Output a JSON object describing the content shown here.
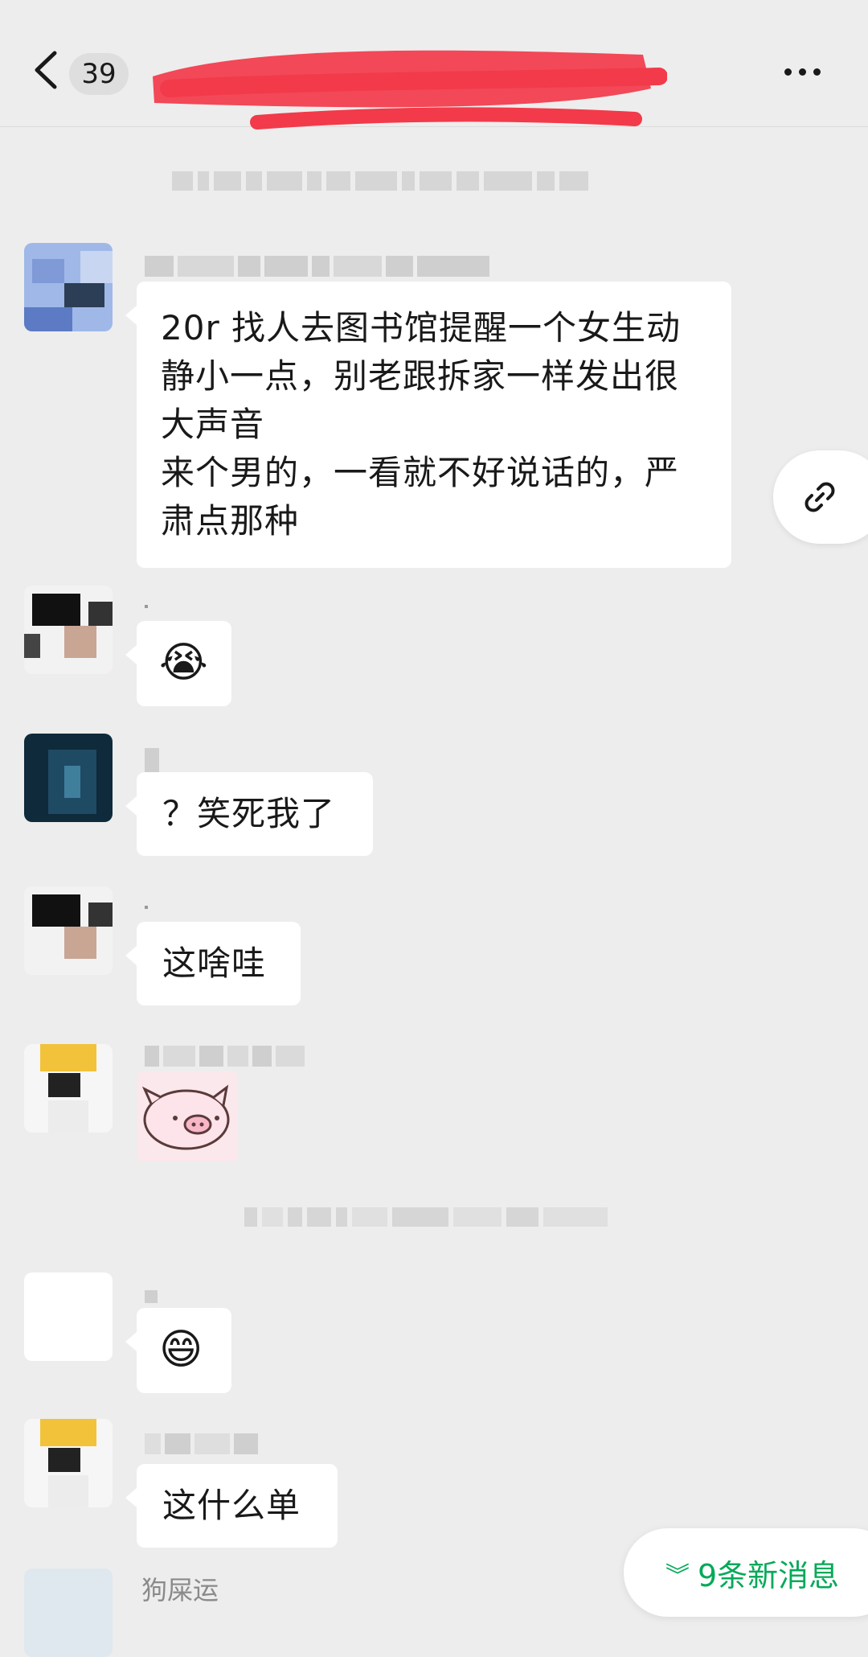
{
  "header": {
    "unread_count": "39",
    "back_icon": "chevron-left-icon",
    "more_icon": "more-dots-icon"
  },
  "floating": {
    "link_icon": "link-icon"
  },
  "messages": [
    {
      "text": "20r 找人去图书馆提醒一个女生动\n静小一点，别老跟拆家一样发出很\n大声音\n来个男的，一看就不好说话的，严\n肃点那种"
    },
    {
      "emoji": "😭"
    },
    {
      "text": "？笑死我了"
    },
    {
      "text": "这啥哇"
    },
    {
      "sticker": "pig-sticker"
    },
    {
      "emoji": "😄"
    },
    {
      "text": "这什么单"
    }
  ],
  "last_sender_name": "狗屎运",
  "new_messages": {
    "label": "9条新消息",
    "icon": "double-chevron-down-icon",
    "color": "#07a95a"
  },
  "colors": {
    "background": "#ededed",
    "bubble": "#ffffff",
    "redaction": "#f23a4a"
  }
}
